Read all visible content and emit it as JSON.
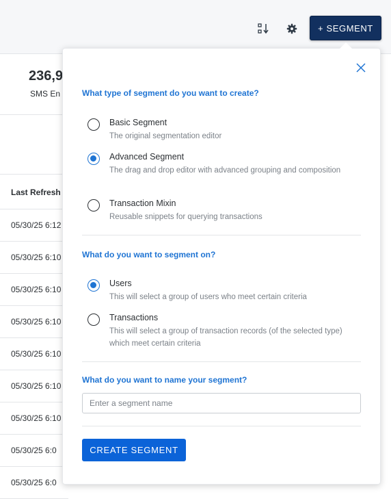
{
  "toolbar": {
    "sort_icon": "sort-icon",
    "settings_icon": "gear-icon",
    "segment_button_label": "+ SEGMENT"
  },
  "background": {
    "stat_value": "236,9",
    "stat_label": "SMS En",
    "table_header": "Last Refresh",
    "rows": [
      "05/30/25 6:12",
      "05/30/25 6:10",
      "05/30/25 6:10",
      "05/30/25 6:10",
      "05/30/25 6:10",
      "05/30/25 6:10",
      "05/30/25 6:10",
      "05/30/25 6:0",
      "05/30/25 6:0"
    ]
  },
  "dialog": {
    "close_icon": "close-icon",
    "type_question": "What type of segment do you want to create?",
    "type_options": [
      {
        "title": "Basic Segment",
        "desc": "The original segmentation editor",
        "selected": false
      },
      {
        "title": "Advanced Segment",
        "desc": "The drag and drop editor with advanced grouping and composition",
        "selected": true
      },
      {
        "title": "Transaction Mixin",
        "desc": "Reusable snippets for querying transactions",
        "selected": false
      }
    ],
    "on_question": "What do you want to segment on?",
    "on_options": [
      {
        "title": "Users",
        "desc": "This will select a group of users who meet certain criteria",
        "selected": true
      },
      {
        "title": "Transactions",
        "desc": "This will select a group of transaction records (of the selected type) which meet certain criteria",
        "selected": false
      }
    ],
    "name_question": "What do you want to name your segment?",
    "name_placeholder": "Enter a segment name",
    "name_value": "",
    "create_button_label": "CREATE SEGMENT",
    "accent_color": "#1f74d3"
  }
}
